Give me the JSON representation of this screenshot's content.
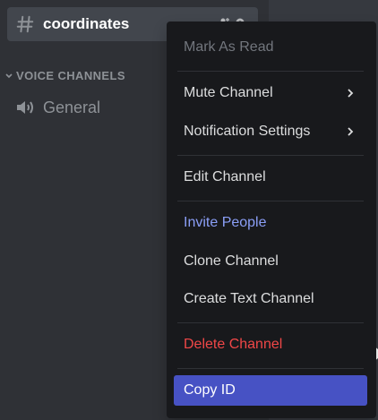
{
  "channel": {
    "name": "coordinates"
  },
  "voice": {
    "category_label": "VOICE CHANNELS",
    "channels": [
      {
        "name": "General"
      }
    ]
  },
  "menu": {
    "items": [
      {
        "label": "Mark As Read"
      },
      {
        "label": "Mute Channel"
      },
      {
        "label": "Notification Settings"
      },
      {
        "label": "Edit Channel"
      },
      {
        "label": "Invite People"
      },
      {
        "label": "Clone Channel"
      },
      {
        "label": "Create Text Channel"
      },
      {
        "label": "Delete Channel"
      },
      {
        "label": "Copy ID"
      }
    ]
  },
  "colors": {
    "sidebar_bg": "#2f3136",
    "menu_bg": "#18191c",
    "accent": "#4752c4",
    "invite": "#8b9ff7",
    "danger": "#f04747"
  }
}
